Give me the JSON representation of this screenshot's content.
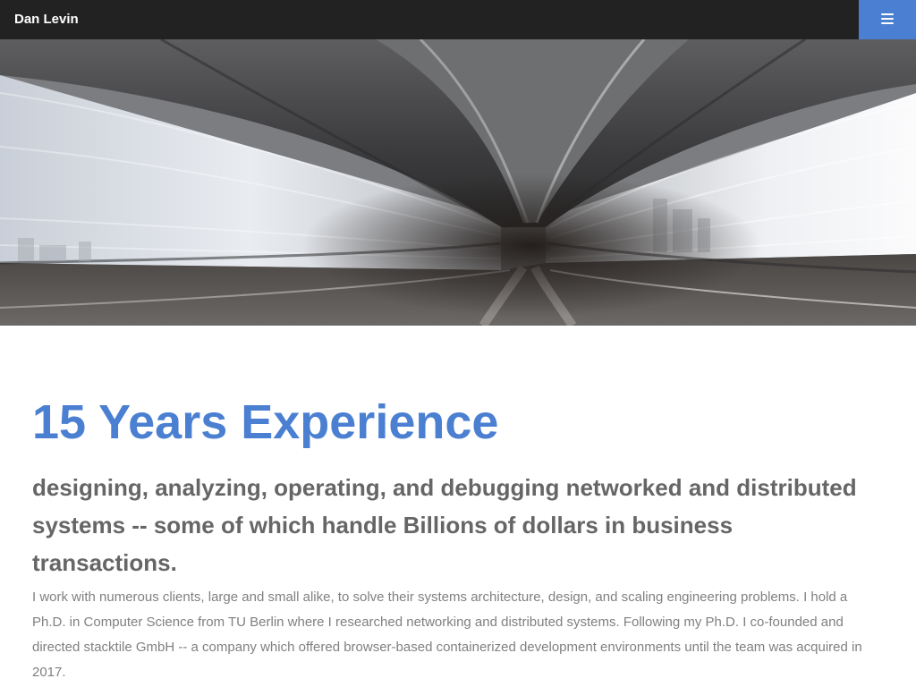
{
  "navbar": {
    "brand": "Dan Levin",
    "menu_icon": "hamburger-menu-icon",
    "accent_color": "#4a7fd1",
    "background_color": "#222222"
  },
  "hero": {
    "image": "motion-blurred-train-tunnel-photo"
  },
  "main": {
    "headline": "15 Years Experience",
    "subheadline": "designing, analyzing, operating, and debugging networked and distributed systems -- some of which handle Billions of dollars in business transactions.",
    "body": "I work with numerous clients, large and small alike, to solve their systems architecture, design, and scaling engineering problems. I hold a Ph.D. in Computer Science from TU Berlin where I researched networking and distributed systems. Following my Ph.D. I co-founded and directed stacktile GmbH -- a company which offered browser-based containerized development environments until the team was acquired in 2017.",
    "headline_color": "#4a7fd1",
    "subheadline_color": "#666666",
    "body_color": "#808080"
  }
}
